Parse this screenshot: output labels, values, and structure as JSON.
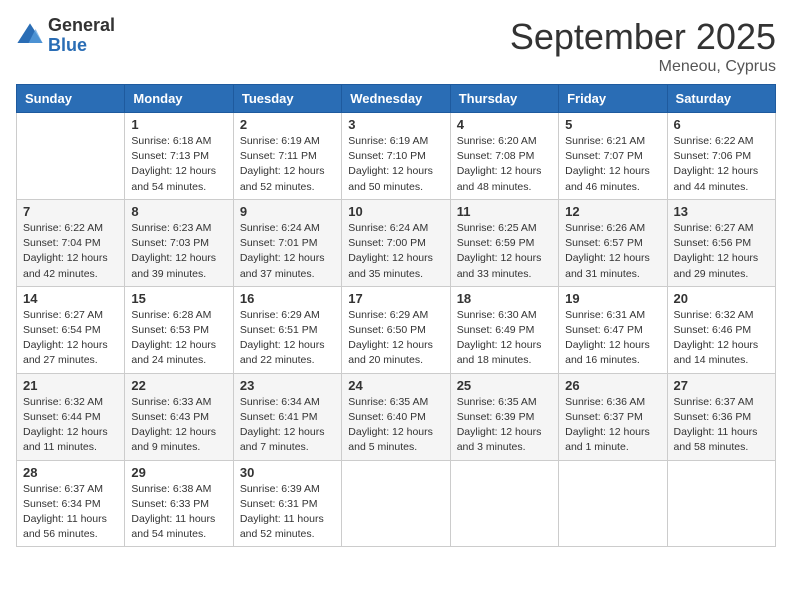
{
  "logo": {
    "general": "General",
    "blue": "Blue"
  },
  "title": "September 2025",
  "location": "Meneou, Cyprus",
  "days_of_week": [
    "Sunday",
    "Monday",
    "Tuesday",
    "Wednesday",
    "Thursday",
    "Friday",
    "Saturday"
  ],
  "weeks": [
    [
      {
        "day": "",
        "info": ""
      },
      {
        "day": "1",
        "info": "Sunrise: 6:18 AM\nSunset: 7:13 PM\nDaylight: 12 hours\nand 54 minutes."
      },
      {
        "day": "2",
        "info": "Sunrise: 6:19 AM\nSunset: 7:11 PM\nDaylight: 12 hours\nand 52 minutes."
      },
      {
        "day": "3",
        "info": "Sunrise: 6:19 AM\nSunset: 7:10 PM\nDaylight: 12 hours\nand 50 minutes."
      },
      {
        "day": "4",
        "info": "Sunrise: 6:20 AM\nSunset: 7:08 PM\nDaylight: 12 hours\nand 48 minutes."
      },
      {
        "day": "5",
        "info": "Sunrise: 6:21 AM\nSunset: 7:07 PM\nDaylight: 12 hours\nand 46 minutes."
      },
      {
        "day": "6",
        "info": "Sunrise: 6:22 AM\nSunset: 7:06 PM\nDaylight: 12 hours\nand 44 minutes."
      }
    ],
    [
      {
        "day": "7",
        "info": "Sunrise: 6:22 AM\nSunset: 7:04 PM\nDaylight: 12 hours\nand 42 minutes."
      },
      {
        "day": "8",
        "info": "Sunrise: 6:23 AM\nSunset: 7:03 PM\nDaylight: 12 hours\nand 39 minutes."
      },
      {
        "day": "9",
        "info": "Sunrise: 6:24 AM\nSunset: 7:01 PM\nDaylight: 12 hours\nand 37 minutes."
      },
      {
        "day": "10",
        "info": "Sunrise: 6:24 AM\nSunset: 7:00 PM\nDaylight: 12 hours\nand 35 minutes."
      },
      {
        "day": "11",
        "info": "Sunrise: 6:25 AM\nSunset: 6:59 PM\nDaylight: 12 hours\nand 33 minutes."
      },
      {
        "day": "12",
        "info": "Sunrise: 6:26 AM\nSunset: 6:57 PM\nDaylight: 12 hours\nand 31 minutes."
      },
      {
        "day": "13",
        "info": "Sunrise: 6:27 AM\nSunset: 6:56 PM\nDaylight: 12 hours\nand 29 minutes."
      }
    ],
    [
      {
        "day": "14",
        "info": "Sunrise: 6:27 AM\nSunset: 6:54 PM\nDaylight: 12 hours\nand 27 minutes."
      },
      {
        "day": "15",
        "info": "Sunrise: 6:28 AM\nSunset: 6:53 PM\nDaylight: 12 hours\nand 24 minutes."
      },
      {
        "day": "16",
        "info": "Sunrise: 6:29 AM\nSunset: 6:51 PM\nDaylight: 12 hours\nand 22 minutes."
      },
      {
        "day": "17",
        "info": "Sunrise: 6:29 AM\nSunset: 6:50 PM\nDaylight: 12 hours\nand 20 minutes."
      },
      {
        "day": "18",
        "info": "Sunrise: 6:30 AM\nSunset: 6:49 PM\nDaylight: 12 hours\nand 18 minutes."
      },
      {
        "day": "19",
        "info": "Sunrise: 6:31 AM\nSunset: 6:47 PM\nDaylight: 12 hours\nand 16 minutes."
      },
      {
        "day": "20",
        "info": "Sunrise: 6:32 AM\nSunset: 6:46 PM\nDaylight: 12 hours\nand 14 minutes."
      }
    ],
    [
      {
        "day": "21",
        "info": "Sunrise: 6:32 AM\nSunset: 6:44 PM\nDaylight: 12 hours\nand 11 minutes."
      },
      {
        "day": "22",
        "info": "Sunrise: 6:33 AM\nSunset: 6:43 PM\nDaylight: 12 hours\nand 9 minutes."
      },
      {
        "day": "23",
        "info": "Sunrise: 6:34 AM\nSunset: 6:41 PM\nDaylight: 12 hours\nand 7 minutes."
      },
      {
        "day": "24",
        "info": "Sunrise: 6:35 AM\nSunset: 6:40 PM\nDaylight: 12 hours\nand 5 minutes."
      },
      {
        "day": "25",
        "info": "Sunrise: 6:35 AM\nSunset: 6:39 PM\nDaylight: 12 hours\nand 3 minutes."
      },
      {
        "day": "26",
        "info": "Sunrise: 6:36 AM\nSunset: 6:37 PM\nDaylight: 12 hours\nand 1 minute."
      },
      {
        "day": "27",
        "info": "Sunrise: 6:37 AM\nSunset: 6:36 PM\nDaylight: 11 hours\nand 58 minutes."
      }
    ],
    [
      {
        "day": "28",
        "info": "Sunrise: 6:37 AM\nSunset: 6:34 PM\nDaylight: 11 hours\nand 56 minutes."
      },
      {
        "day": "29",
        "info": "Sunrise: 6:38 AM\nSunset: 6:33 PM\nDaylight: 11 hours\nand 54 minutes."
      },
      {
        "day": "30",
        "info": "Sunrise: 6:39 AM\nSunset: 6:31 PM\nDaylight: 11 hours\nand 52 minutes."
      },
      {
        "day": "",
        "info": ""
      },
      {
        "day": "",
        "info": ""
      },
      {
        "day": "",
        "info": ""
      },
      {
        "day": "",
        "info": ""
      }
    ]
  ]
}
